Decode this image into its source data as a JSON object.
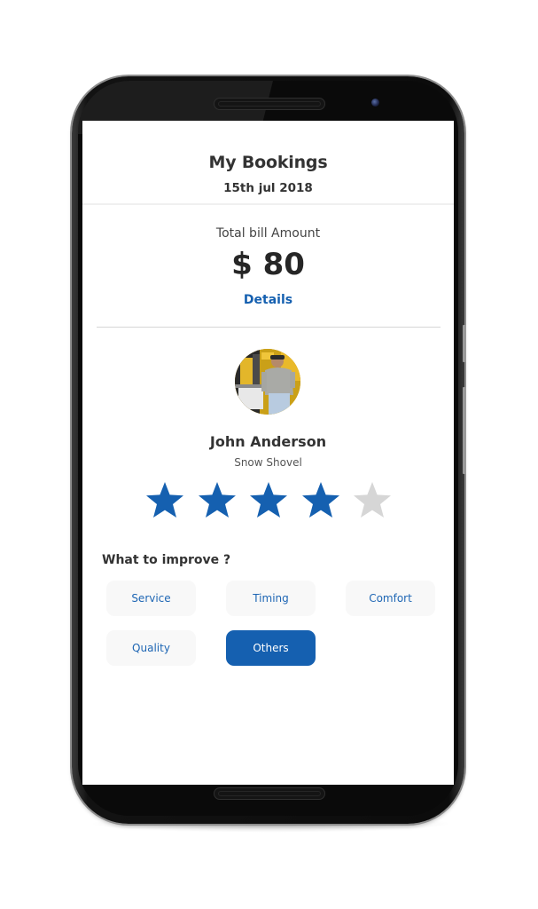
{
  "header": {
    "title": "My Bookings",
    "date": "15th jul 2018"
  },
  "bill": {
    "label": "Total bill Amount",
    "amount": "$ 80",
    "details_link": "Details"
  },
  "provider": {
    "avatar_icon": "provider-photo",
    "name": "John Anderson",
    "service": "Snow Shovel"
  },
  "rating": {
    "value": 4,
    "max": 5,
    "filled_color": "#1560b0",
    "empty_color": "#d6d6d6"
  },
  "improve": {
    "title": "What to improve ?",
    "options": [
      {
        "label": "Service",
        "selected": false
      },
      {
        "label": "Timing",
        "selected": false
      },
      {
        "label": "Comfort",
        "selected": false
      },
      {
        "label": "Quality",
        "selected": false
      },
      {
        "label": "Others",
        "selected": true
      }
    ]
  },
  "colors": {
    "accent": "#1560b0",
    "chip_bg": "#f8f8f8",
    "text": "#333333"
  }
}
